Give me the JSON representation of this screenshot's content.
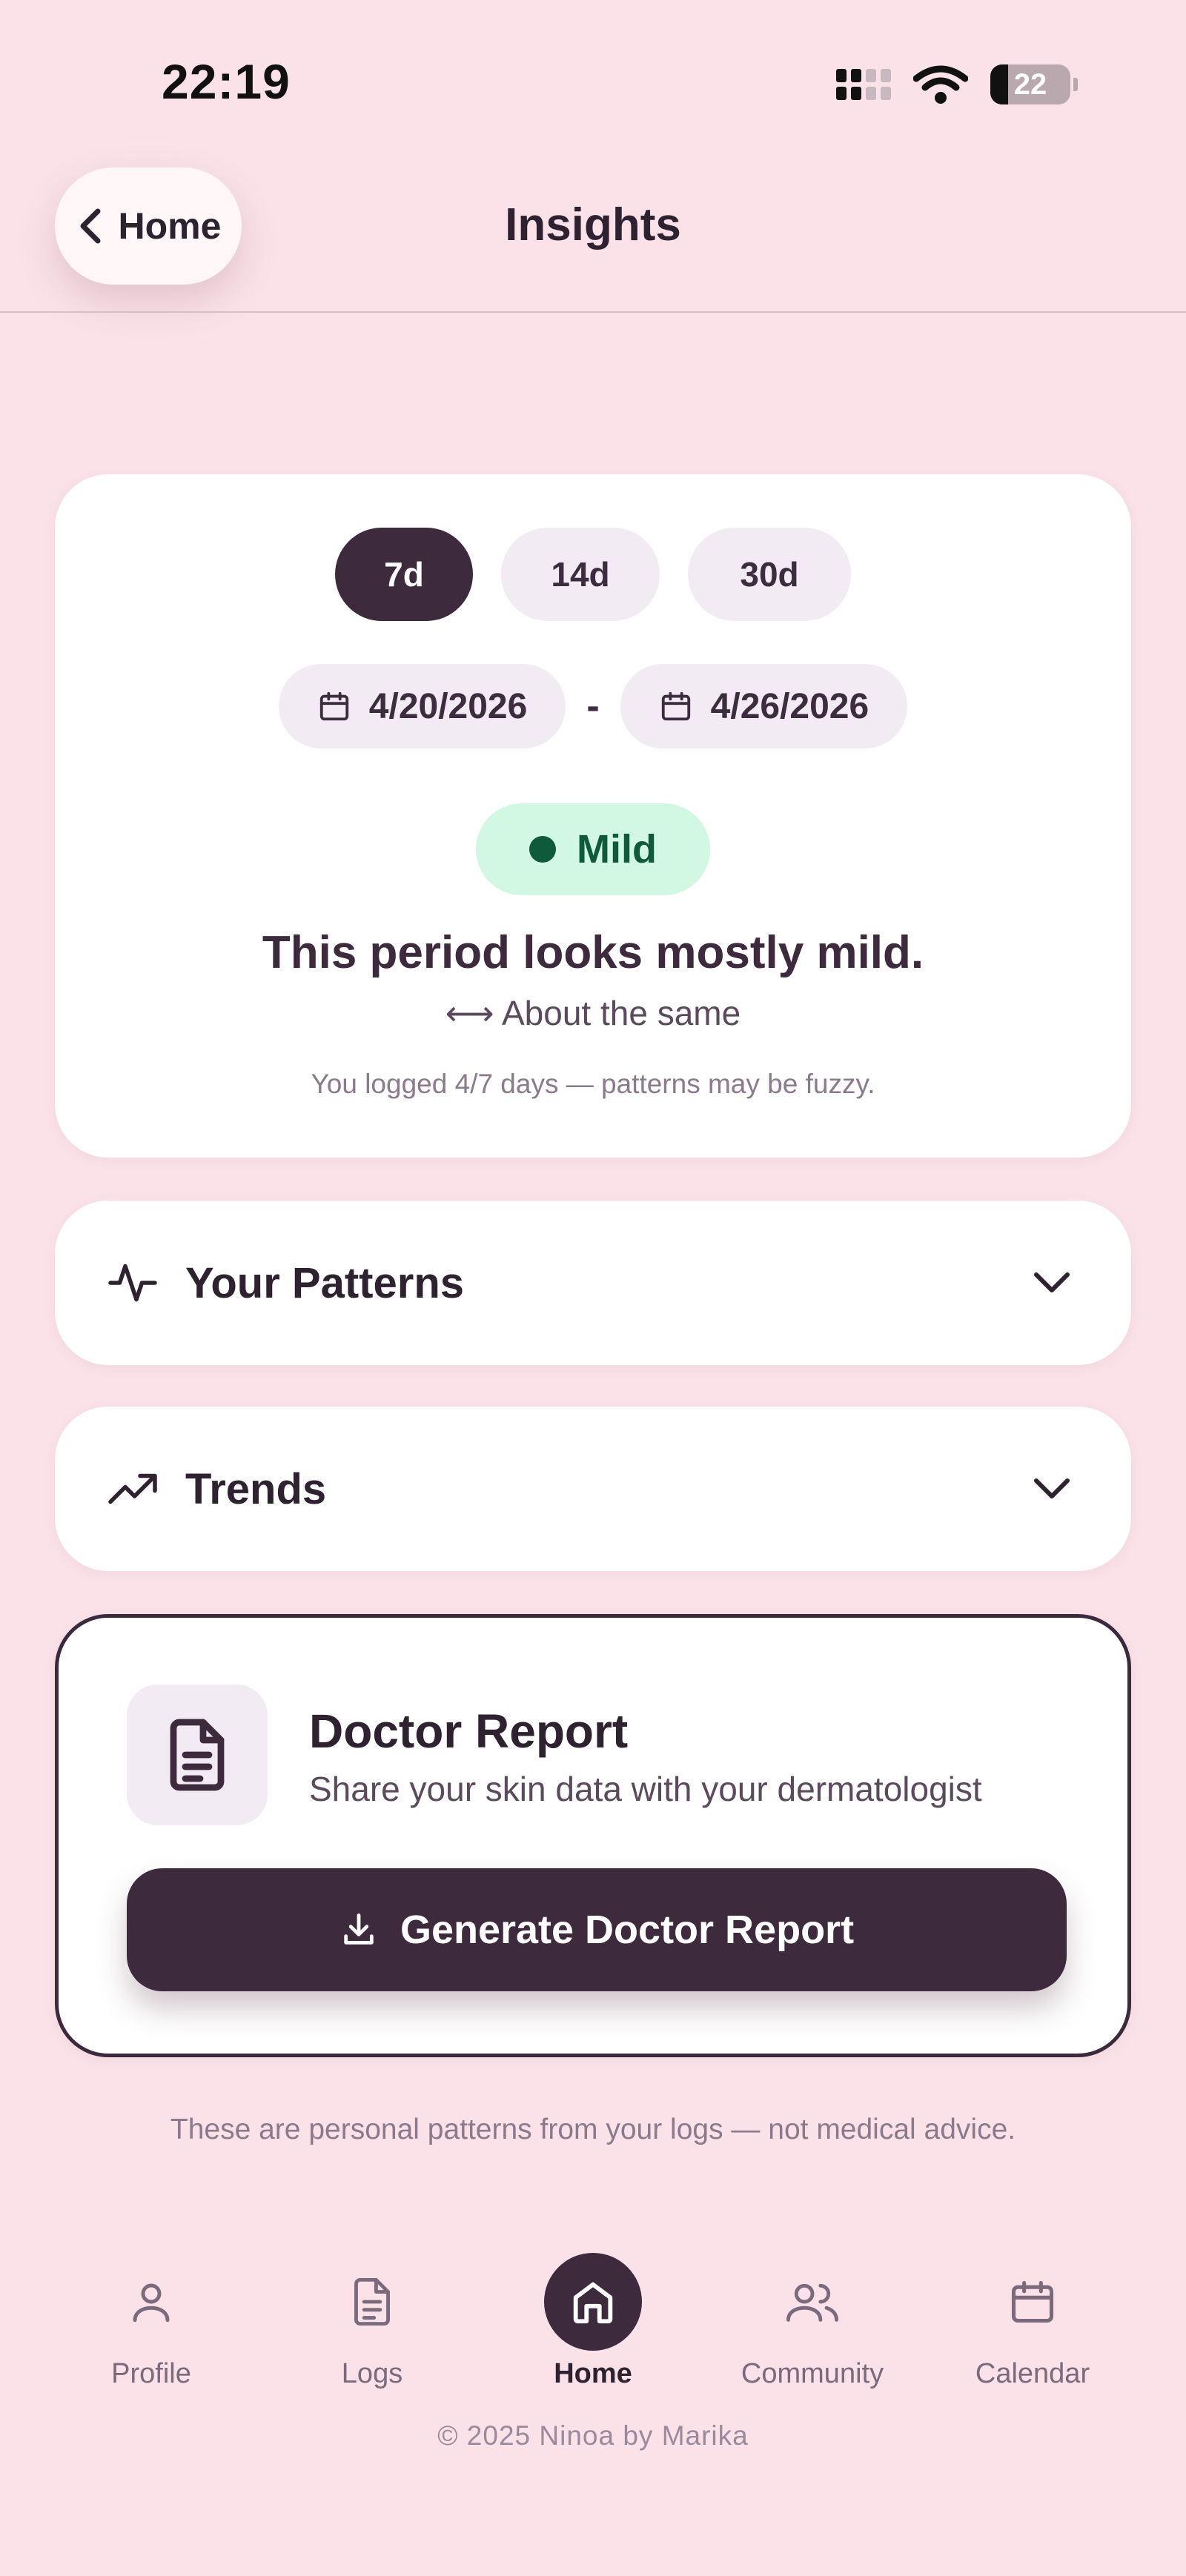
{
  "status_bar": {
    "time": "22:19",
    "battery": "22"
  },
  "header": {
    "back_label": "Home",
    "title": "Insights"
  },
  "range_tabs": [
    {
      "label": "7d",
      "active": true
    },
    {
      "label": "14d",
      "active": false
    },
    {
      "label": "30d",
      "active": false
    }
  ],
  "date_range": {
    "start": "4/20/2026",
    "separator": "-",
    "end": "4/26/2026"
  },
  "summary": {
    "severity": "Mild",
    "severity_color": "#0f5a3a",
    "headline": "This period looks mostly mild.",
    "trend": "⟷ About the same",
    "log_note": "You logged 4/7 days — patterns may be fuzzy."
  },
  "sections": {
    "patterns_title": "Your Patterns",
    "trends_title": "Trends"
  },
  "report": {
    "title": "Doctor Report",
    "subtitle": "Share your skin data with your dermatologist",
    "button_label": "Generate Doctor Report"
  },
  "disclaimer": "These are personal patterns from your logs — not medical advice.",
  "nav": {
    "items": [
      {
        "label": "Profile",
        "icon": "user-icon"
      },
      {
        "label": "Logs",
        "icon": "document-icon"
      },
      {
        "label": "Home",
        "icon": "home-icon",
        "active": true
      },
      {
        "label": "Community",
        "icon": "users-icon"
      },
      {
        "label": "Calendar",
        "icon": "calendar-icon"
      }
    ]
  },
  "footer": {
    "copyright": "© 2025 Ninoa by Marika"
  },
  "colors": {
    "background": "#fae2e8",
    "accent": "#3d2a3d",
    "mild_bg": "#d2f8e4"
  }
}
